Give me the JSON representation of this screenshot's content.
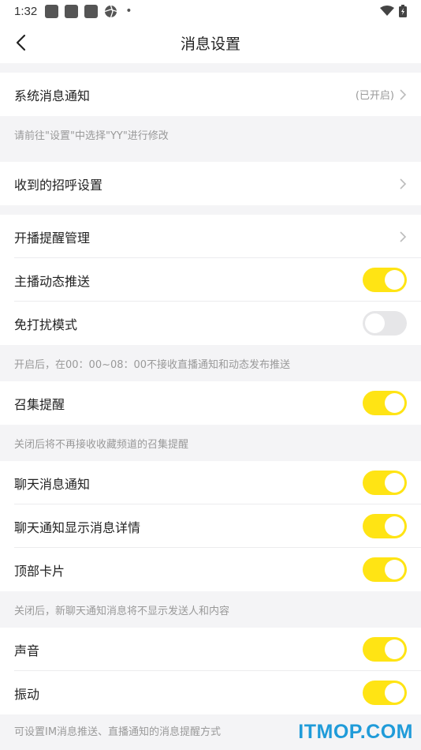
{
  "status_bar": {
    "time": "1:32"
  },
  "header": {
    "title": "消息设置"
  },
  "sections": {
    "system": {
      "label": "系统消息通知",
      "value": "(已开启)",
      "note": "请前往\"设置\"中选择\"YY\"进行修改"
    },
    "greet": {
      "label": "收到的招呼设置"
    },
    "live_reminder": {
      "label": "开播提醒管理"
    },
    "anchor_push": {
      "label": "主播动态推送",
      "state": "on"
    },
    "dnd": {
      "label": "免打扰模式",
      "state": "off",
      "note": "开启后，在00：00~08：00不接收直播通知和动态发布推送"
    },
    "gather": {
      "label": "召集提醒",
      "state": "on",
      "note": "关闭后将不再接收收藏频道的召集提醒"
    },
    "chat_notify": {
      "label": "聊天消息通知",
      "state": "on"
    },
    "chat_detail": {
      "label": "聊天通知显示消息详情",
      "state": "on"
    },
    "top_card": {
      "label": "顶部卡片",
      "state": "on",
      "note": "关闭后，新聊天通知消息将不显示发送人和内容"
    },
    "sound": {
      "label": "声音",
      "state": "on"
    },
    "vibrate": {
      "label": "振动",
      "state": "on",
      "note": "可设置IM消息推送、直播通知的消息提醒方式"
    }
  },
  "colors": {
    "toggle_on": "#ffe414",
    "toggle_off": "#e6e6e8",
    "watermark": "#1f9bd9"
  },
  "watermark": "ITMOP.COM"
}
